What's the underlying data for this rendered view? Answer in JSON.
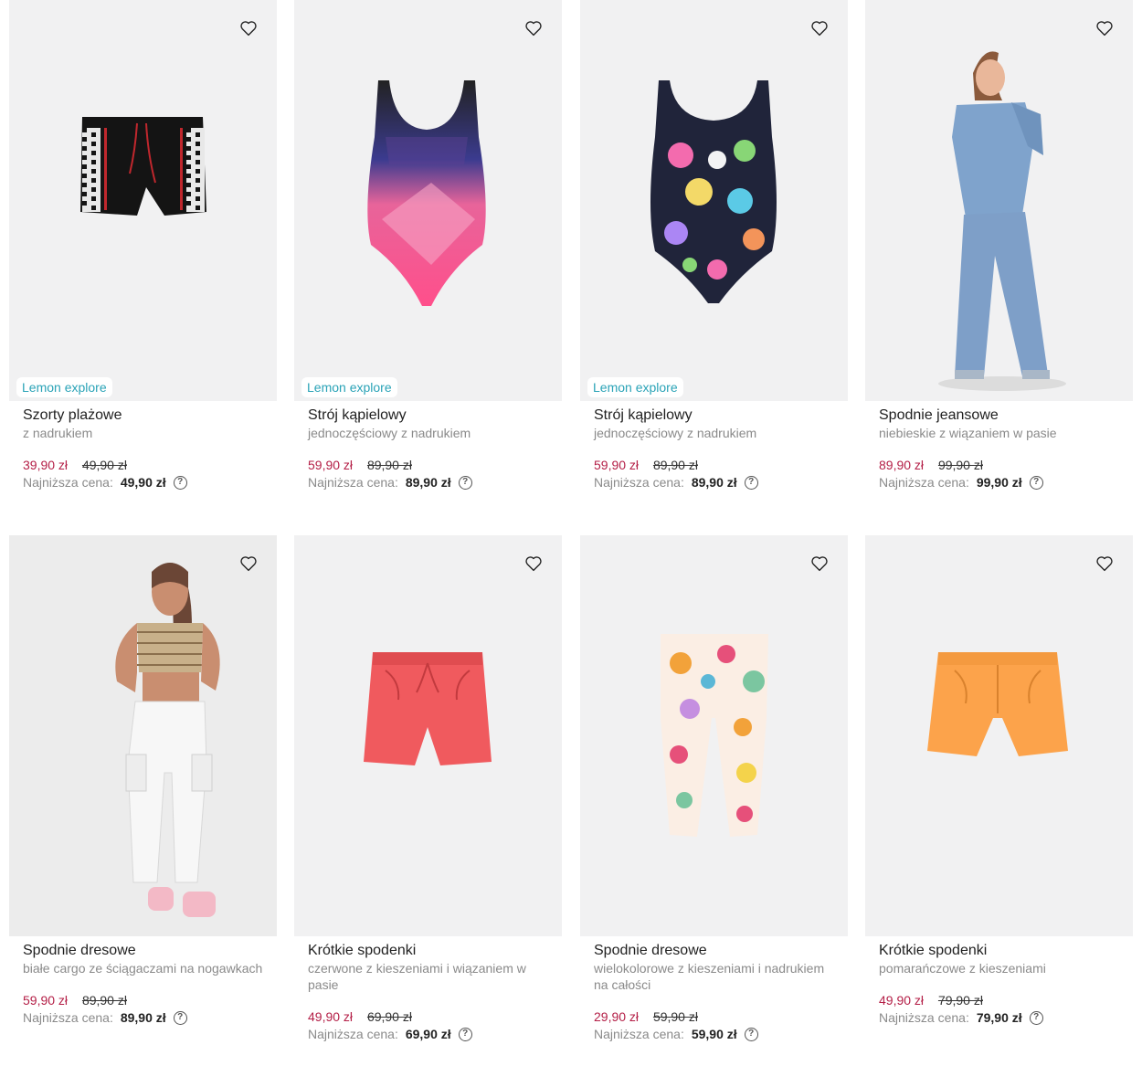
{
  "products": [
    {
      "title": "Szorty plażowe",
      "subtitle": "z nadrukiem",
      "badge": "Lemon explore",
      "price_new": "39,90 zł",
      "price_old": "49,90 zł",
      "lowest_label": "Najniższa cena:",
      "lowest_value": "49,90 zł",
      "image": "black-shorts"
    },
    {
      "title": "Strój kąpielowy",
      "subtitle": "jednoczęściowy z nadrukiem",
      "badge": "Lemon explore",
      "price_new": "59,90 zł",
      "price_old": "89,90 zł",
      "lowest_label": "Najniższa cena:",
      "lowest_value": "89,90 zł",
      "image": "pink-swimsuit"
    },
    {
      "title": "Strój kąpielowy",
      "subtitle": "jednoczęściowy z nadrukiem",
      "badge": "Lemon explore",
      "price_new": "59,90 zł",
      "price_old": "89,90 zł",
      "lowest_label": "Najniższa cena:",
      "lowest_value": "89,90 zł",
      "image": "patterned-swimsuit"
    },
    {
      "title": "Spodnie jeansowe",
      "subtitle": "niebieskie z wiązaniem w pasie",
      "badge": "",
      "price_new": "89,90 zł",
      "price_old": "99,90 zł",
      "lowest_label": "Najniższa cena:",
      "lowest_value": "99,90 zł",
      "image": "model-jeans"
    },
    {
      "title": "Spodnie dresowe",
      "subtitle": "białe cargo ze ściągaczami na nogawkach",
      "badge": "",
      "price_new": "59,90 zł",
      "price_old": "89,90 zł",
      "lowest_label": "Najniższa cena:",
      "lowest_value": "89,90 zł",
      "image": "model-cargo"
    },
    {
      "title": "Krótkie spodenki",
      "subtitle": "czerwone z kieszeniami i wiązaniem w pasie",
      "badge": "",
      "price_new": "49,90 zł",
      "price_old": "69,90 zł",
      "lowest_label": "Najniższa cena:",
      "lowest_value": "69,90 zł",
      "image": "red-shorts"
    },
    {
      "title": "Spodnie dresowe",
      "subtitle": "wielokolorowe z kieszeniami i nadrukiem na całości",
      "badge": "",
      "price_new": "29,90 zł",
      "price_old": "59,90 zł",
      "lowest_label": "Najniższa cena:",
      "lowest_value": "59,90 zł",
      "image": "floral-leggings"
    },
    {
      "title": "Krótkie spodenki",
      "subtitle": "pomarańczowe z kieszeniami",
      "badge": "",
      "price_new": "49,90 zł",
      "price_old": "79,90 zł",
      "lowest_label": "Najniższa cena:",
      "lowest_value": "79,90 zł",
      "image": "orange-shorts"
    }
  ],
  "icons": {
    "favorite": "heart-outline-icon",
    "help": "question-circle-icon"
  },
  "colors": {
    "sale_price": "#b41f47",
    "badge_text": "#2aa3b7",
    "card_bg": "#f1f1f2"
  }
}
